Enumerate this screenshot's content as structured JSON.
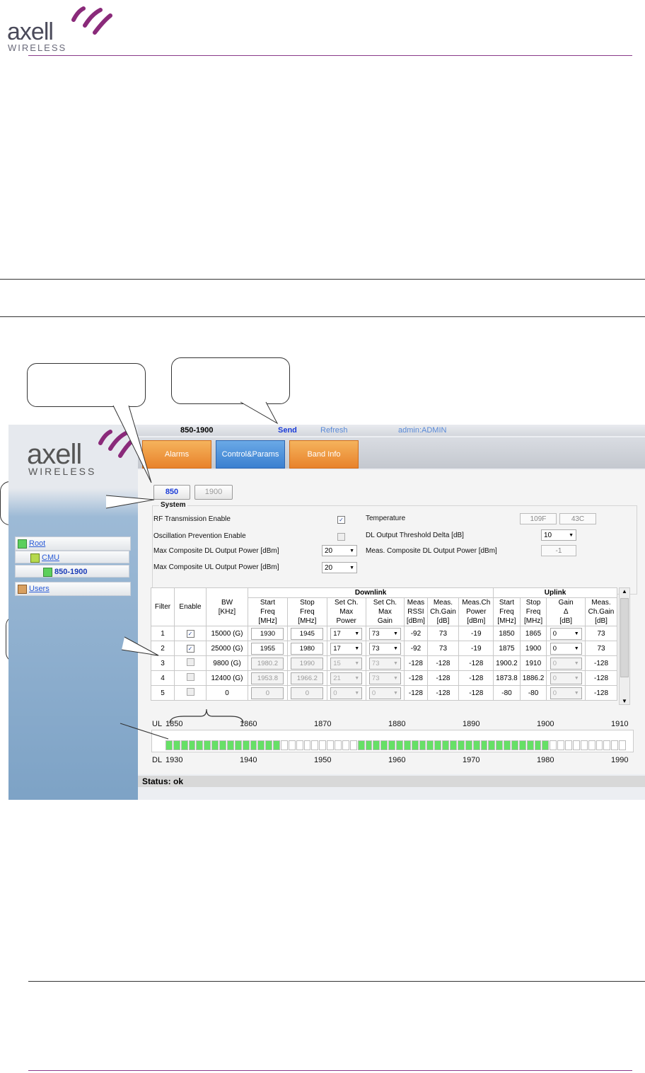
{
  "doc_header": {
    "logo_word": "axell",
    "logo_sub": "WIRELESS"
  },
  "app": {
    "logo_word": "axell",
    "logo_sub": "WIRELESS",
    "topbar": {
      "device": "850-1900",
      "send": "Send",
      "refresh": "Refresh",
      "user": "admin:ADMIN"
    },
    "tabs": [
      {
        "label": "Alarms"
      },
      {
        "label": "Control&Params"
      },
      {
        "label": "Band Info"
      }
    ],
    "tree": {
      "root": "Root",
      "cmu": "CMU",
      "device": "850-1900",
      "users": "Users"
    },
    "band_tabs": [
      "850",
      "1900"
    ],
    "system": {
      "title": "System",
      "rf_enable": "RF Transmission Enable",
      "osc_enable": "Oscillation Prevention Enable",
      "max_dl": "Max Composite DL Output Power [dBm]",
      "max_dl_value": "20",
      "max_ul": "Max Composite UL Output Power [dBm]",
      "max_ul_value": "20",
      "temperature": "Temperature",
      "temp_f": "109F",
      "temp_c": "43C",
      "dl_threshold": "DL Output Threshold Delta [dB]",
      "dl_threshold_value": "10",
      "meas_dl": "Meas. Composite DL Output Power [dBm]",
      "meas_dl_value": "-1"
    },
    "table": {
      "group_downlink": "Downlink",
      "group_uplink": "Uplink",
      "headers": {
        "filter": "Filter",
        "enable": "Enable",
        "bw": [
          "BW",
          "[KHz]"
        ],
        "dl_start": [
          "Start",
          "Freq",
          "[MHz]"
        ],
        "dl_stop": [
          "Stop",
          "Freq",
          "[MHz]"
        ],
        "set_power": [
          "Set Ch.",
          "Max",
          "Power"
        ],
        "set_gain": [
          "Set Ch.",
          "Max",
          "Gain"
        ],
        "rssi": [
          "Meas",
          "RSSI",
          "[dBm]"
        ],
        "ch_gain": [
          "Meas.",
          "Ch.Gain",
          "[dB]"
        ],
        "ch_power": [
          "Meas.Ch",
          "Power",
          "[dBm]"
        ],
        "ul_start": [
          "Start",
          "Freq",
          "[MHz]"
        ],
        "ul_stop": [
          "Stop",
          "Freq",
          "[MHz]"
        ],
        "gain_delta": [
          "Gain",
          "Δ",
          "[dB]"
        ],
        "ul_ch_gain": [
          "Meas.",
          "Ch.Gain",
          "[dB]"
        ]
      },
      "rows": [
        {
          "filter": "1",
          "bw": "15000 (G)",
          "dl_start": "1930",
          "dl_stop": "1945",
          "power": "17",
          "gain": "73",
          "rssi": "-92",
          "ch_gain": "73",
          "ch_power": "-19",
          "ul_start": "1850",
          "ul_stop": "1865",
          "gain_delta": "0",
          "ul_ch_gain": "73"
        },
        {
          "filter": "2",
          "bw": "25000 (G)",
          "dl_start": "1955",
          "dl_stop": "1980",
          "power": "17",
          "gain": "73",
          "rssi": "-92",
          "ch_gain": "73",
          "ch_power": "-19",
          "ul_start": "1875",
          "ul_stop": "1900",
          "gain_delta": "0",
          "ul_ch_gain": "73"
        },
        {
          "filter": "3",
          "bw": "9800 (G)",
          "dl_start": "1980.2",
          "dl_stop": "1990",
          "power": "15",
          "gain": "73",
          "rssi": "-128",
          "ch_gain": "-128",
          "ch_power": "-128",
          "ul_start": "1900.2",
          "ul_stop": "1910",
          "gain_delta": "0",
          "ul_ch_gain": "-128"
        },
        {
          "filter": "4",
          "bw": "12400 (G)",
          "dl_start": "1953.8",
          "dl_stop": "1966.2",
          "power": "21",
          "gain": "73",
          "rssi": "-128",
          "ch_gain": "-128",
          "ch_power": "-128",
          "ul_start": "1873.8",
          "ul_stop": "1886.2",
          "gain_delta": "0",
          "ul_ch_gain": "-128"
        },
        {
          "filter": "5",
          "bw": "0",
          "dl_start": "0",
          "dl_stop": "0",
          "power": "0",
          "gain": "0",
          "rssi": "-128",
          "ch_gain": "-128",
          "ch_power": "-128",
          "ul_start": "-80",
          "ul_stop": "-80",
          "gain_delta": "0",
          "ul_ch_gain": "-128"
        }
      ]
    },
    "spectrum": {
      "ul_label": "UL",
      "dl_label": "DL",
      "ul_ticks": [
        "1850",
        "1860",
        "1870",
        "1880",
        "1890",
        "1900",
        "1910"
      ],
      "dl_ticks": [
        "1930",
        "1940",
        "1950",
        "1960",
        "1970",
        "1980",
        "1990"
      ],
      "cells": 60,
      "active_ranges": [
        [
          0,
          15
        ],
        [
          25,
          50
        ]
      ],
      "active_color": "#66e066"
    },
    "status": "Status: ok"
  },
  "colors": {
    "brand_purple": "#8a3a8a",
    "tab_orange": "#e8822b",
    "tab_blue": "#3a7fd0",
    "link_blue": "#2a5bd7"
  }
}
